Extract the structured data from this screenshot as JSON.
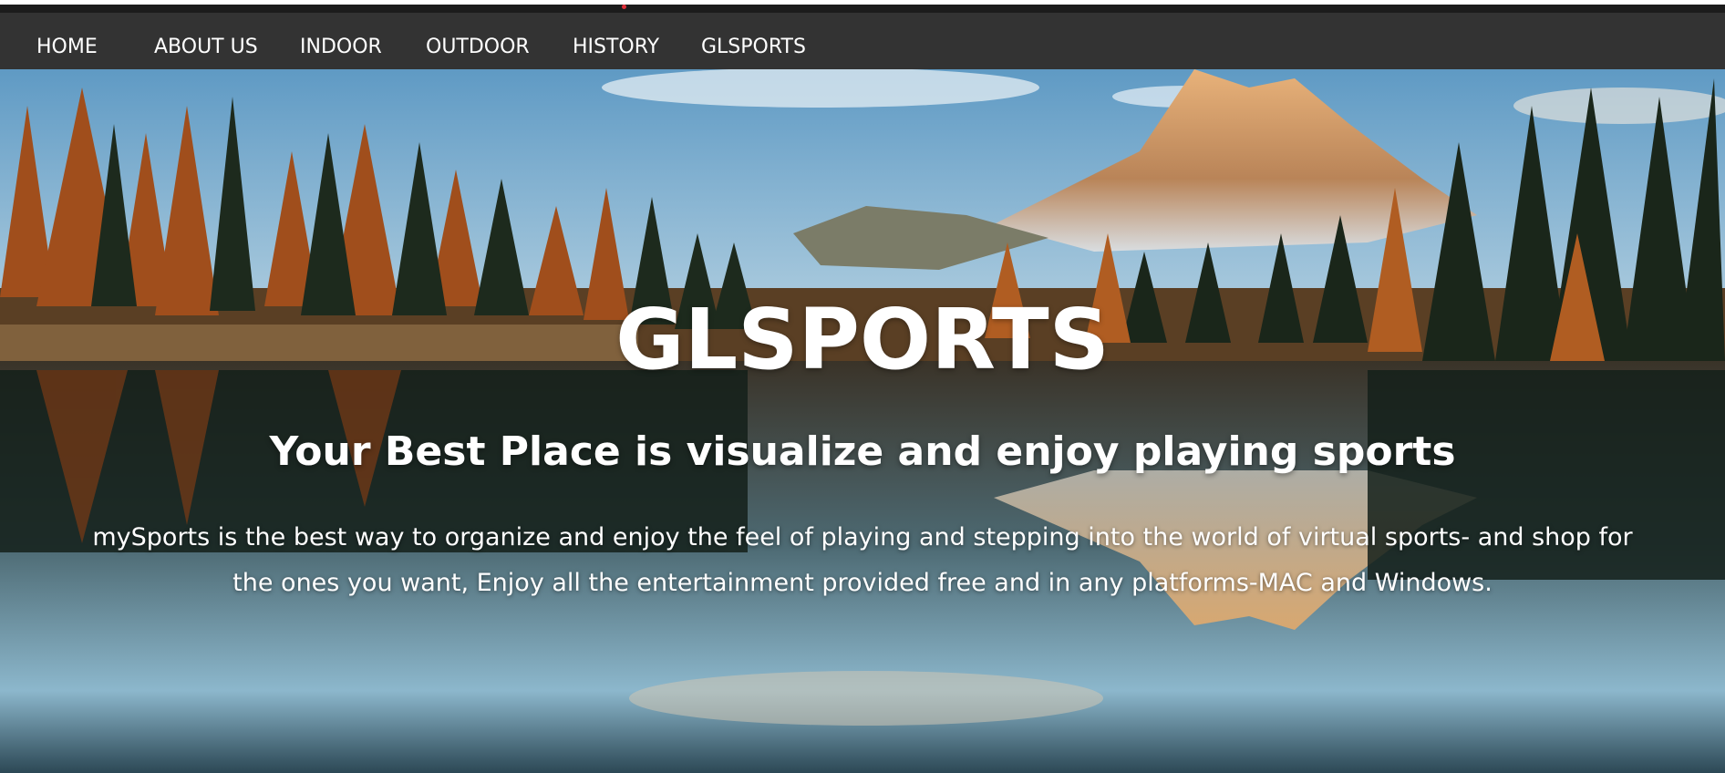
{
  "nav": {
    "items": [
      {
        "label": "HOME"
      },
      {
        "label": "ABOUT US"
      },
      {
        "label": "INDOOR"
      },
      {
        "label": "OUTDOOR"
      },
      {
        "label": "HISTORY"
      },
      {
        "label": "GLSPORTS"
      }
    ]
  },
  "hero": {
    "title": "GLSPORTS",
    "subtitle": "Your Best Place is visualize and enjoy playing sports",
    "description": "mySports is the best way to organize and enjoy the feel of playing and stepping into the world of virtual sports- and shop for the ones you want, Enjoy all the entertainment provided free and in any platforms-MAC and Windows."
  },
  "colors": {
    "navbar_bg": "#333333",
    "nav_text": "#ffffff",
    "hero_text": "#ffffff"
  }
}
